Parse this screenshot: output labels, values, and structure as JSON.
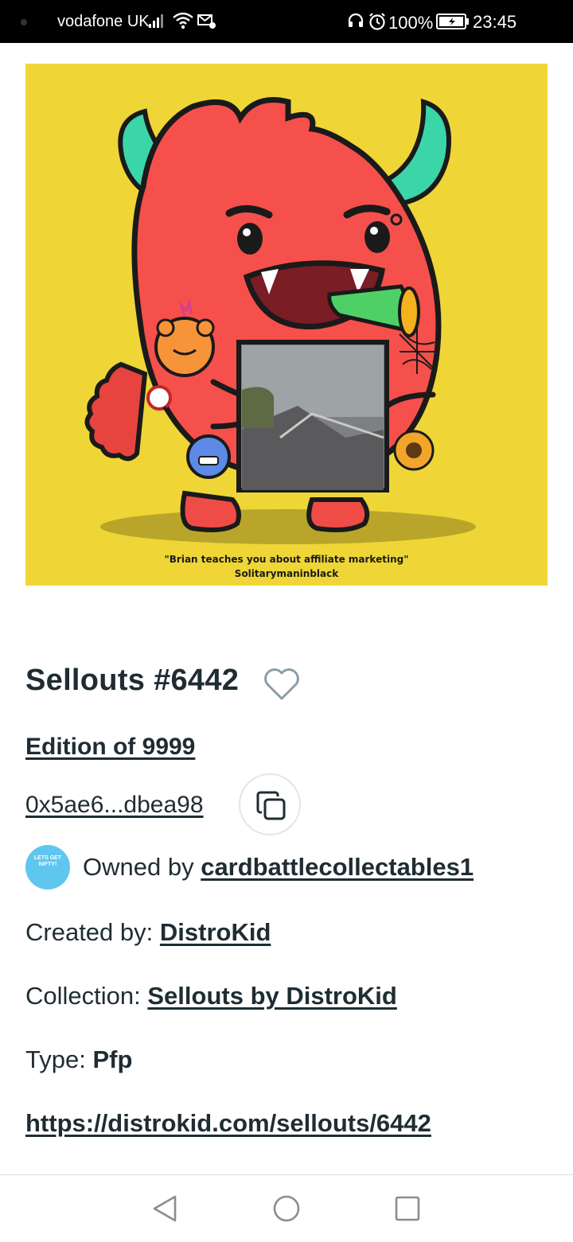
{
  "status_bar": {
    "carrier": "vodafone UK",
    "battery_percent": "100%",
    "time": "23:45",
    "icons": [
      "signal-icon",
      "wifi-icon",
      "message-icon",
      "headset-icon",
      "alarm-icon",
      "battery-icon"
    ]
  },
  "artwork": {
    "caption_line1": "\"Brian teaches you about affiliate marketing\"",
    "caption_line2": "Solitarymaninblack",
    "background_color": "#efd636"
  },
  "nft": {
    "title": "Sellouts #6442",
    "edition": "Edition of 9999",
    "address": "0x5ae6...dbea98",
    "owner_prefix": "Owned by",
    "owner": "cardbattlecollectables1",
    "owner_avatar_text": "LETS GET NIFTY!",
    "created_by_label": "Created by:",
    "creator": "DistroKid",
    "collection_label": "Collection:",
    "collection": "Sellouts by DistroKid",
    "type_label": "Type:",
    "type": "Pfp",
    "url": "https://distrokid.com/sellouts/6442"
  },
  "nav_bar": {
    "icons": [
      "back-icon",
      "home-icon",
      "recents-icon"
    ]
  }
}
